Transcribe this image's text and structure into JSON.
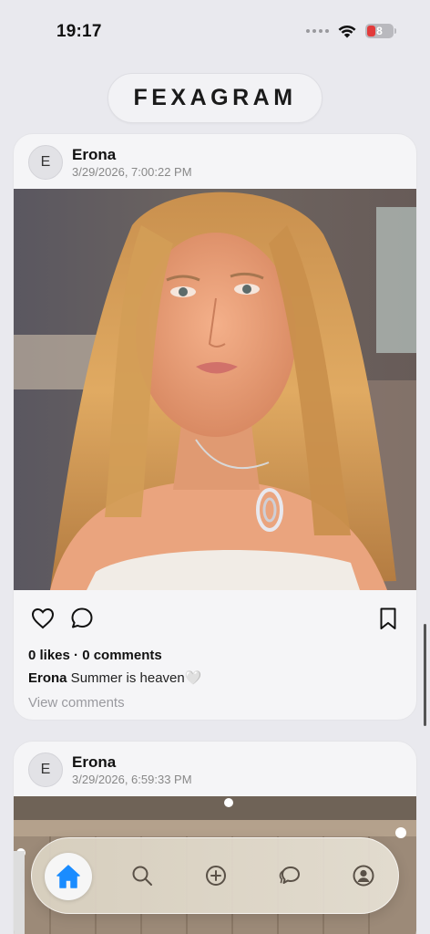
{
  "status": {
    "time": "19:17",
    "battery": "8"
  },
  "app": {
    "title": "FEXAGRAM"
  },
  "posts": [
    {
      "avatar_letter": "E",
      "author": "Erona",
      "timestamp": "3/29/2026, 7:00:22 PM",
      "stats": "0 likes · 0 comments",
      "caption_author": "Erona",
      "caption_text": " Summer is heaven🤍",
      "view_comments": "View comments"
    },
    {
      "avatar_letter": "E",
      "author": "Erona",
      "timestamp": "3/29/2026, 6:59:33 PM"
    }
  ],
  "icons": {
    "like": "heart-icon",
    "comment": "speech-bubble-icon",
    "save": "bookmark-icon",
    "nav": [
      "home-icon",
      "search-icon",
      "plus-circle-icon",
      "chat-icon",
      "profile-icon"
    ]
  },
  "colors": {
    "background": "#e9e9ee",
    "accent": "#1a8cff",
    "battery_low": "#e23b3b"
  }
}
